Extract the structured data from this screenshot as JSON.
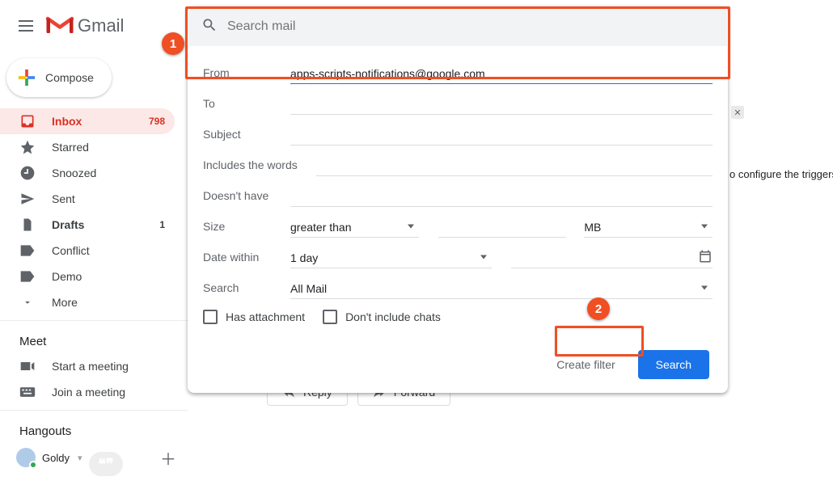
{
  "app": {
    "name": "Gmail"
  },
  "search": {
    "placeholder": "Search mail",
    "from_label": "From",
    "from_value": "apps-scripts-notifications@google.com",
    "to_label": "To",
    "subject_label": "Subject",
    "includes_label": "Includes the words",
    "excludes_label": "Doesn't have",
    "size_label": "Size",
    "size_operator": "greater than",
    "size_unit": "MB",
    "date_label": "Date within",
    "date_window": "1 day",
    "search_scope_label": "Search",
    "search_scope_value": "All Mail",
    "has_attachment": "Has attachment",
    "exclude_chats": "Don't include chats",
    "create_filter": "Create filter",
    "search_btn": "Search"
  },
  "compose": {
    "label": "Compose"
  },
  "sidebar": {
    "items": [
      {
        "label": "Inbox",
        "badge": "798"
      },
      {
        "label": "Starred"
      },
      {
        "label": "Snoozed"
      },
      {
        "label": "Sent"
      },
      {
        "label": "Drafts",
        "badge": "1"
      },
      {
        "label": "Conflict"
      },
      {
        "label": "Demo"
      },
      {
        "label": "More"
      }
    ]
  },
  "meet": {
    "title": "Meet",
    "start": "Start a meeting",
    "join": "Join a meeting"
  },
  "hangouts": {
    "title": "Hangouts",
    "user": "Goldy"
  },
  "reply_bar": {
    "reply": "Reply",
    "forward": "Forward"
  },
  "bg": {
    "snippet": "o configure the triggers fo"
  },
  "annotations": {
    "one": "1",
    "two": "2"
  }
}
